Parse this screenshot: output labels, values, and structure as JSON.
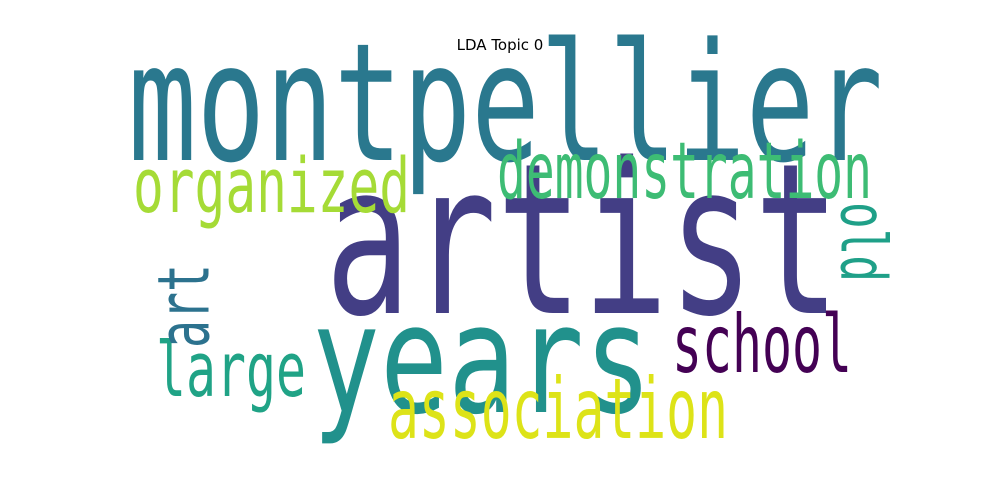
{
  "chart_data": {
    "type": "wordcloud",
    "title": "LDA Topic 0",
    "words": [
      {
        "text": "artist",
        "weight": 1.0,
        "color": "#433e85",
        "orientation": "horizontal"
      },
      {
        "text": "montpellier",
        "weight": 0.78,
        "color": "#2a788e",
        "orientation": "horizontal"
      },
      {
        "text": "years",
        "weight": 0.72,
        "color": "#21918c",
        "orientation": "horizontal"
      },
      {
        "text": "association",
        "weight": 0.4,
        "color": "#dde318",
        "orientation": "horizontal"
      },
      {
        "text": "school",
        "weight": 0.38,
        "color": "#440154",
        "orientation": "horizontal"
      },
      {
        "text": "demonstration",
        "weight": 0.37,
        "color": "#3dbc74",
        "orientation": "horizontal"
      },
      {
        "text": "organized",
        "weight": 0.36,
        "color": "#a5db36",
        "orientation": "horizontal"
      },
      {
        "text": "large",
        "weight": 0.36,
        "color": "#20a386",
        "orientation": "horizontal"
      },
      {
        "text": "art",
        "weight": 0.34,
        "color": "#2c728e",
        "orientation": "vertical"
      },
      {
        "text": "old",
        "weight": 0.3,
        "color": "#1fa088",
        "orientation": "vertical"
      }
    ]
  }
}
